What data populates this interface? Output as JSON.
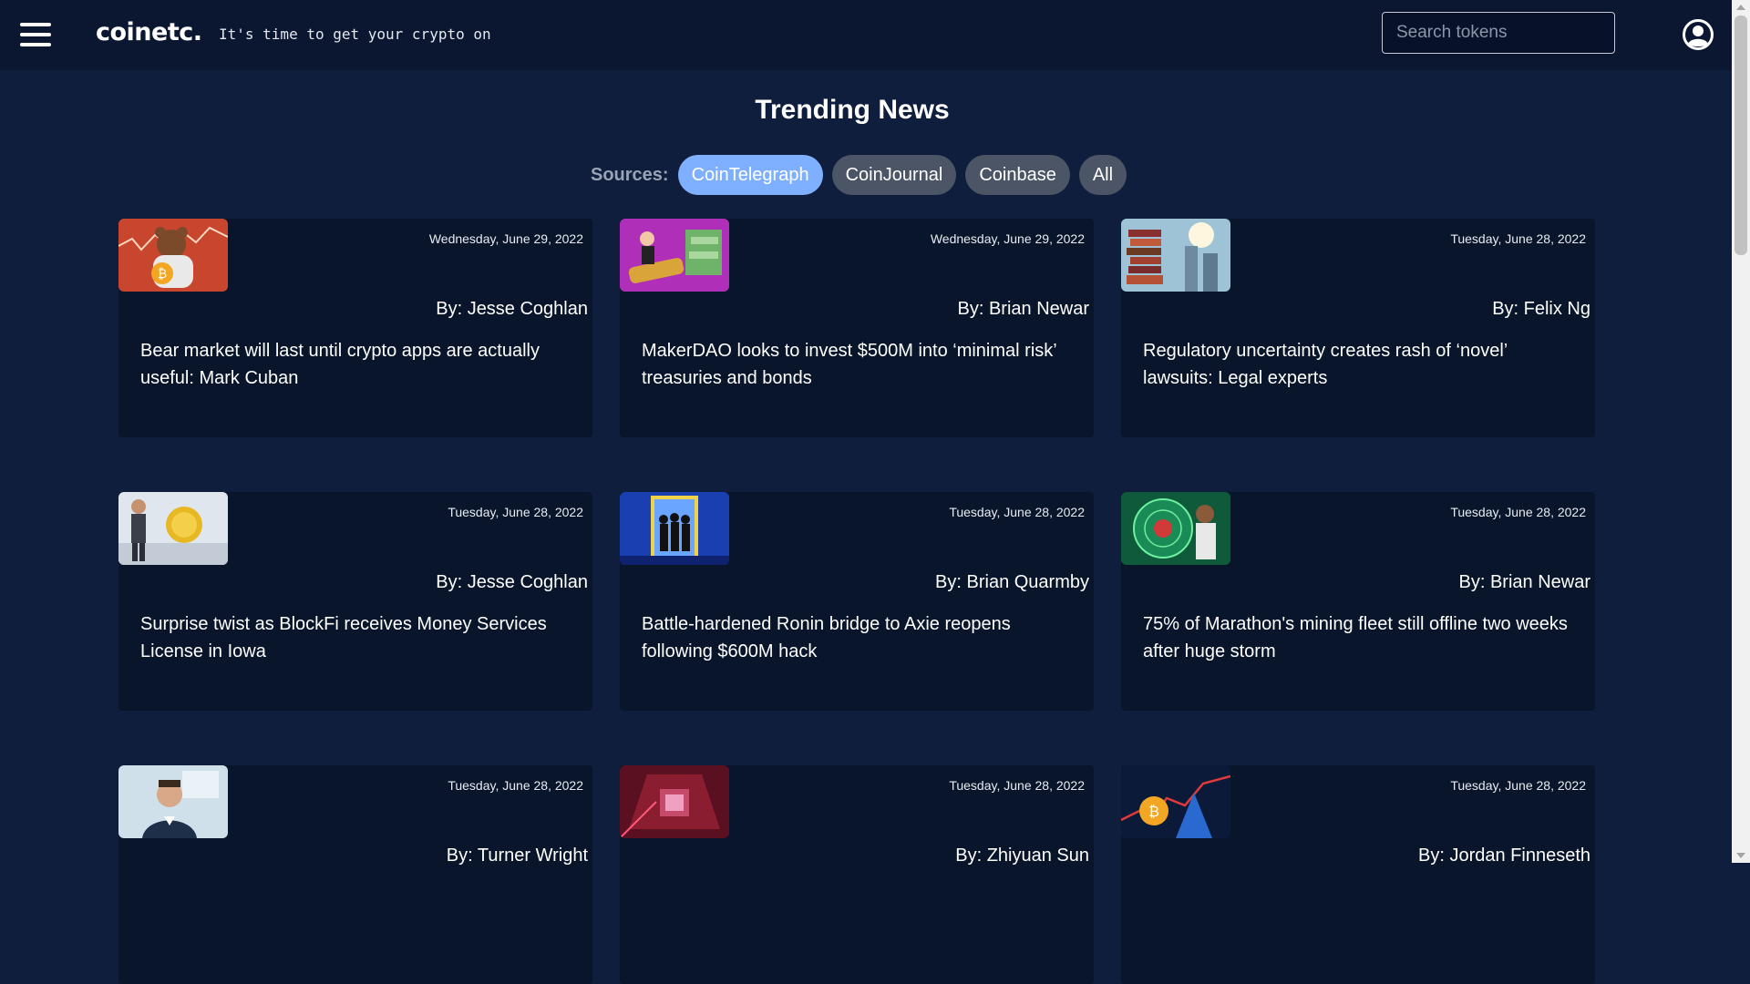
{
  "header": {
    "logo": "coinetc.",
    "tagline": "It's time to get your crypto on",
    "search_placeholder": "Search tokens"
  },
  "icons": {
    "menu": "hamburger-menu-icon",
    "account": "user-account-icon"
  },
  "main": {
    "title": "Trending News",
    "sources_label": "Sources:",
    "sources": [
      {
        "label": "CoinTelegraph",
        "active": true
      },
      {
        "label": "CoinJournal",
        "active": false
      },
      {
        "label": "Coinbase",
        "active": false
      },
      {
        "label": "All",
        "active": false
      }
    ]
  },
  "colors": {
    "background": "#0f1e3c",
    "topbar": "#0b1730",
    "card": "#09152a",
    "active_chip": "#7fb0ff",
    "inactive_chip": "#4c5566"
  },
  "articles": [
    {
      "date": "Wednesday, June 29, 2022",
      "author": "By: Jesse Coghlan",
      "title": "Bear market will last until crypto apps are actually useful: Mark Cuban",
      "image": "bear-with-bitcoin-illustration"
    },
    {
      "date": "Wednesday, June 29, 2022",
      "author": "By: Brian Newar",
      "title": "MakerDAO looks to invest $500M into ‘minimal risk’ treasuries and bonds",
      "image": "money-cannon-illustration"
    },
    {
      "date": "Tuesday, June 28, 2022",
      "author": "By: Felix Ng",
      "title": "Regulatory uncertainty creates rash of ‘novel’ lawsuits: Legal experts",
      "image": "stacked-books-city-illustration"
    },
    {
      "date": "Tuesday, June 28, 2022",
      "author": "By: Jesse Coghlan",
      "title": "Surprise twist as BlockFi receives Money Services License in Iowa",
      "image": "man-with-coin-illustration"
    },
    {
      "date": "Tuesday, June 28, 2022",
      "author": "By: Brian Quarmby",
      "title": "Battle-hardened Ronin bridge to Axie reopens following $600M hack",
      "image": "group-in-doorway-illustration"
    },
    {
      "date": "Tuesday, June 28, 2022",
      "author": "By: Brian Newar",
      "title": "75% of Marathon's mining fleet still offline two weeks after huge storm",
      "image": "radar-scientist-illustration"
    },
    {
      "date": "Tuesday, June 28, 2022",
      "author": "By: Turner Wright",
      "title": "",
      "image": "portrait-photo"
    },
    {
      "date": "Tuesday, June 28, 2022",
      "author": "By: Zhiyuan Sun",
      "title": "",
      "image": "red-room-illustration"
    },
    {
      "date": "Tuesday, June 28, 2022",
      "author": "By: Jordan Finneseth",
      "title": "",
      "image": "bitcoin-chart-illustration"
    }
  ]
}
